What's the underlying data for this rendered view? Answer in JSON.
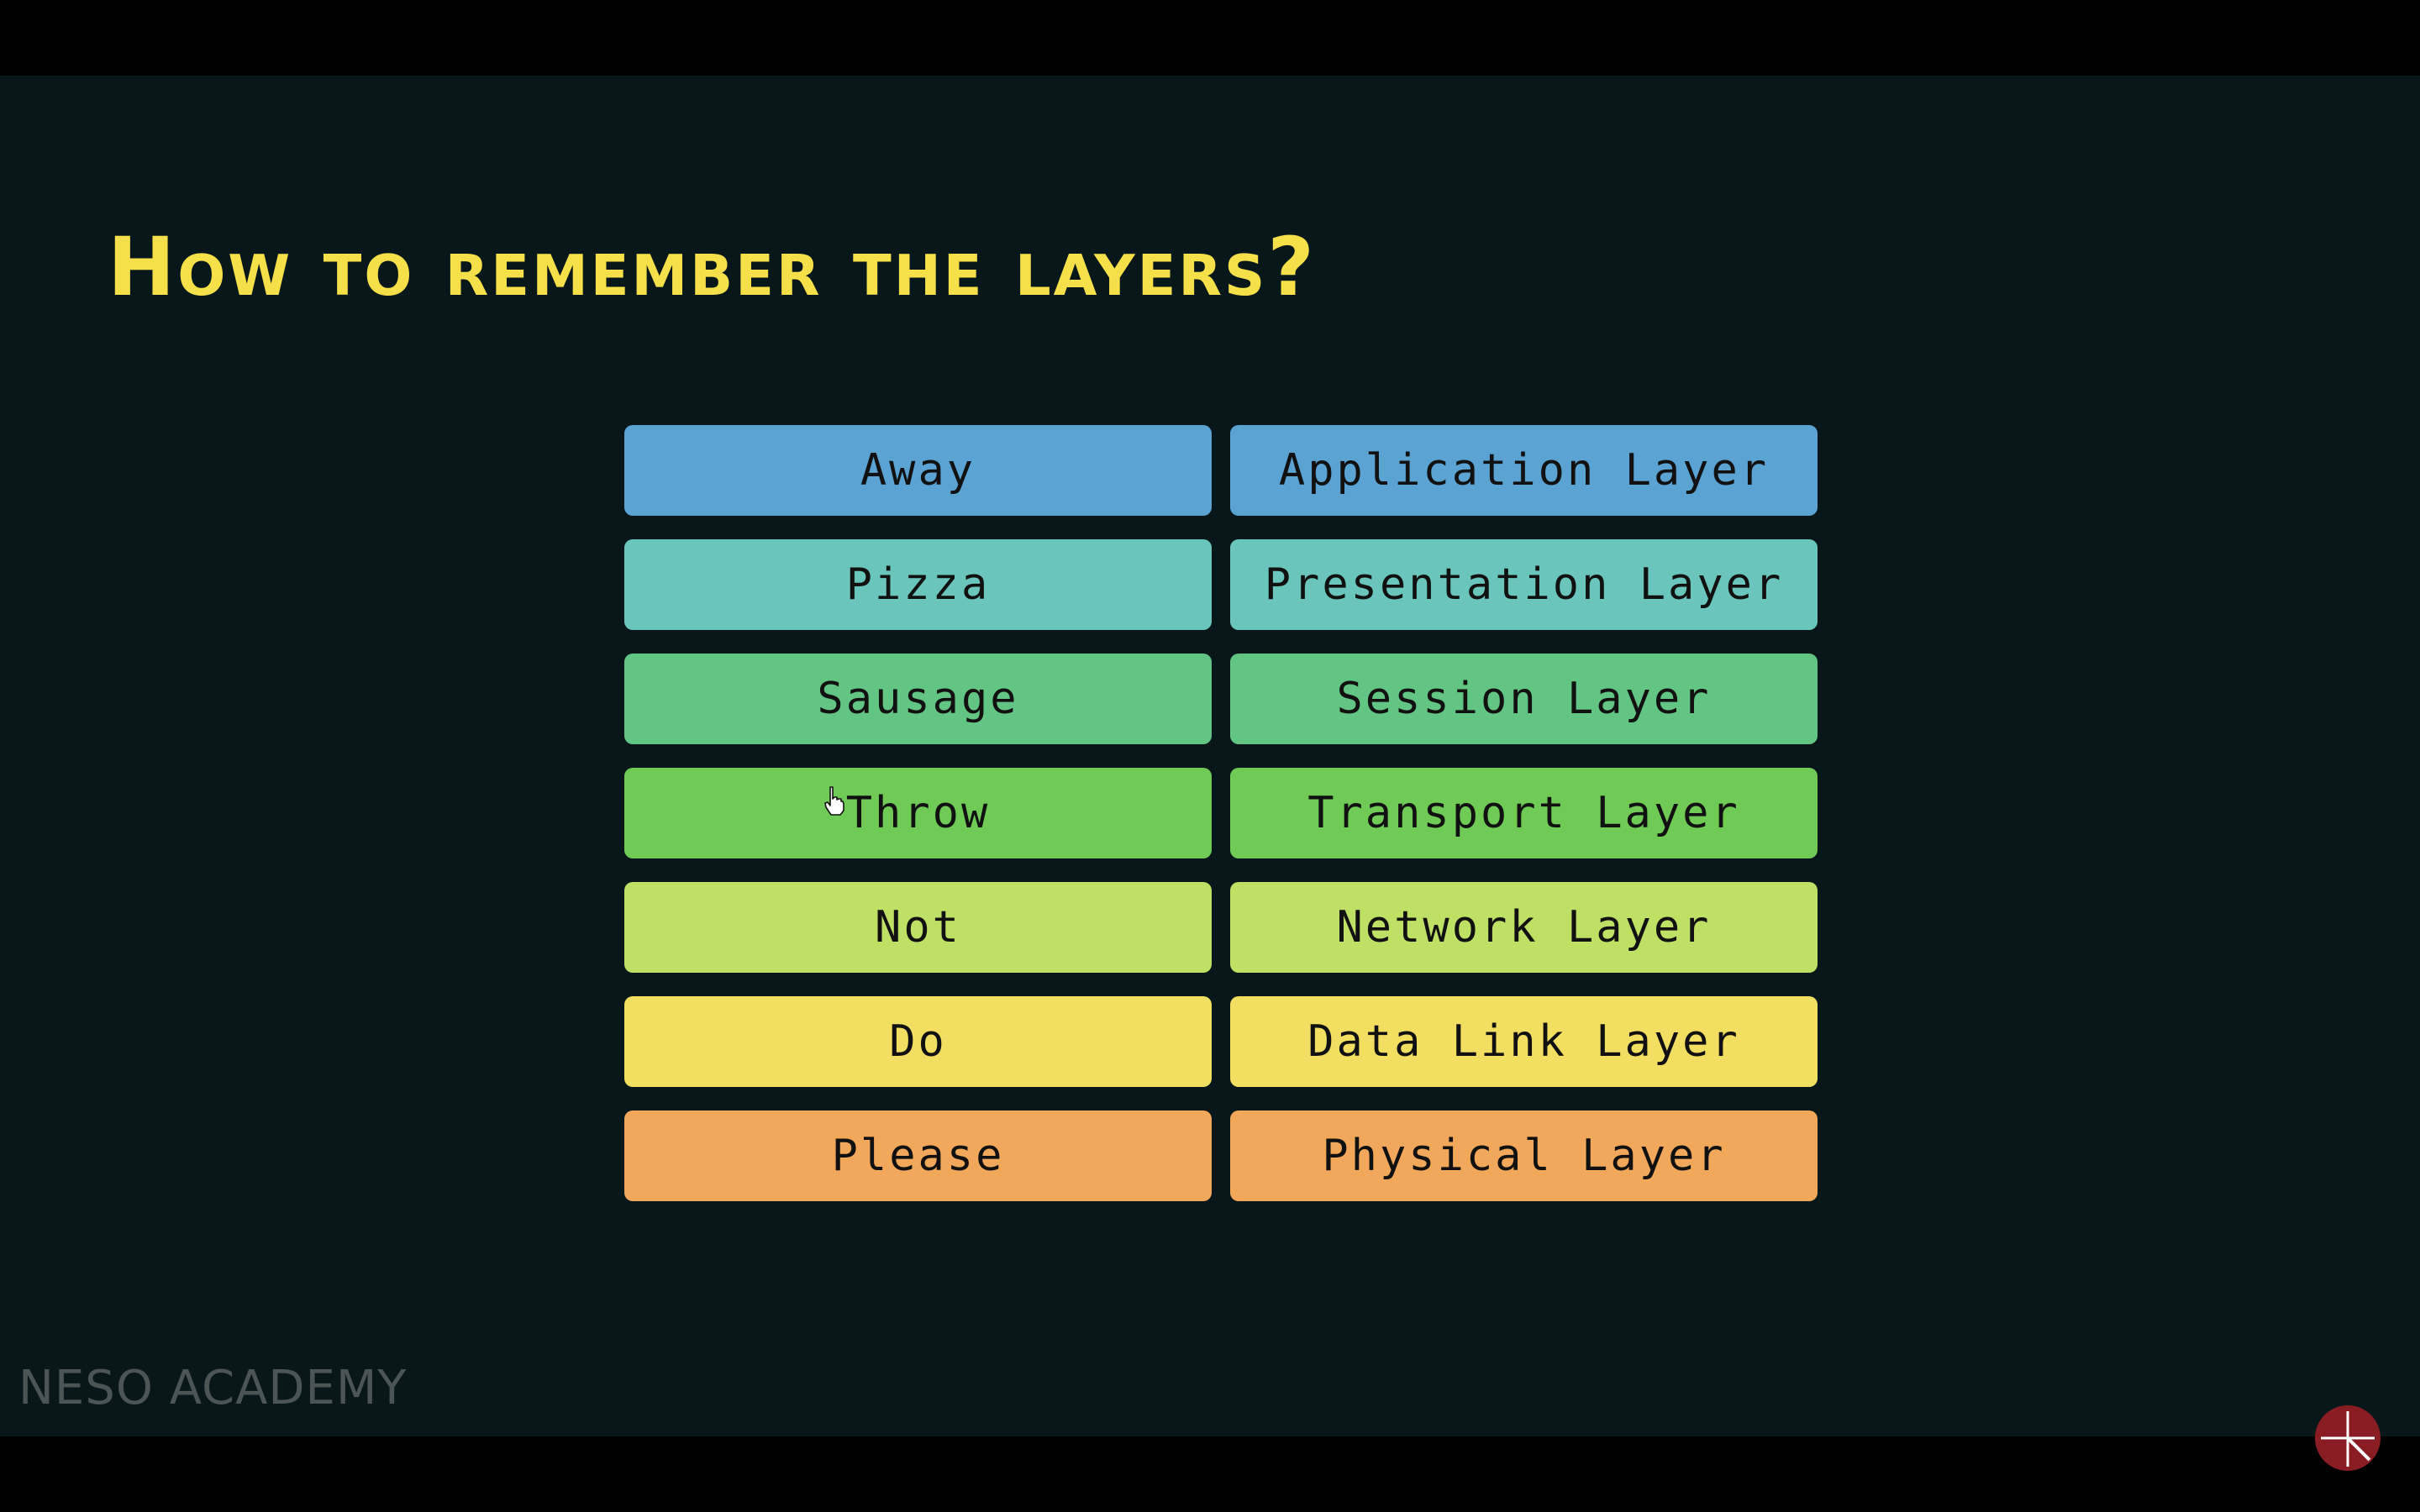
{
  "title": "How to remember the layers?",
  "watermark": "NESO ACADEMY",
  "rows": [
    {
      "mnemonic": "Away",
      "layer": "Application Layer",
      "color": "#5aa3d3"
    },
    {
      "mnemonic": "Pizza",
      "layer": "Presentation Layer",
      "color": "#6ac6bc"
    },
    {
      "mnemonic": "Sausage",
      "layer": "Session Layer",
      "color": "#63c584"
    },
    {
      "mnemonic": "Throw",
      "layer": "Transport Layer",
      "color": "#6fcb55"
    },
    {
      "mnemonic": "Not",
      "layer": "Network Layer",
      "color": "#bde065"
    },
    {
      "mnemonic": "Do",
      "layer": "Data Link Layer",
      "color": "#f2df62"
    },
    {
      "mnemonic": "Please",
      "layer": "Physical Layer",
      "color": "#f1a85a"
    }
  ],
  "colors": {
    "background": "#08171a",
    "title": "#f6e04a",
    "watermark": "#4b5556",
    "logo": "#8a1c24"
  },
  "icons": {
    "cursor": "hand-pointer-icon",
    "logo": "player-logo-icon"
  }
}
